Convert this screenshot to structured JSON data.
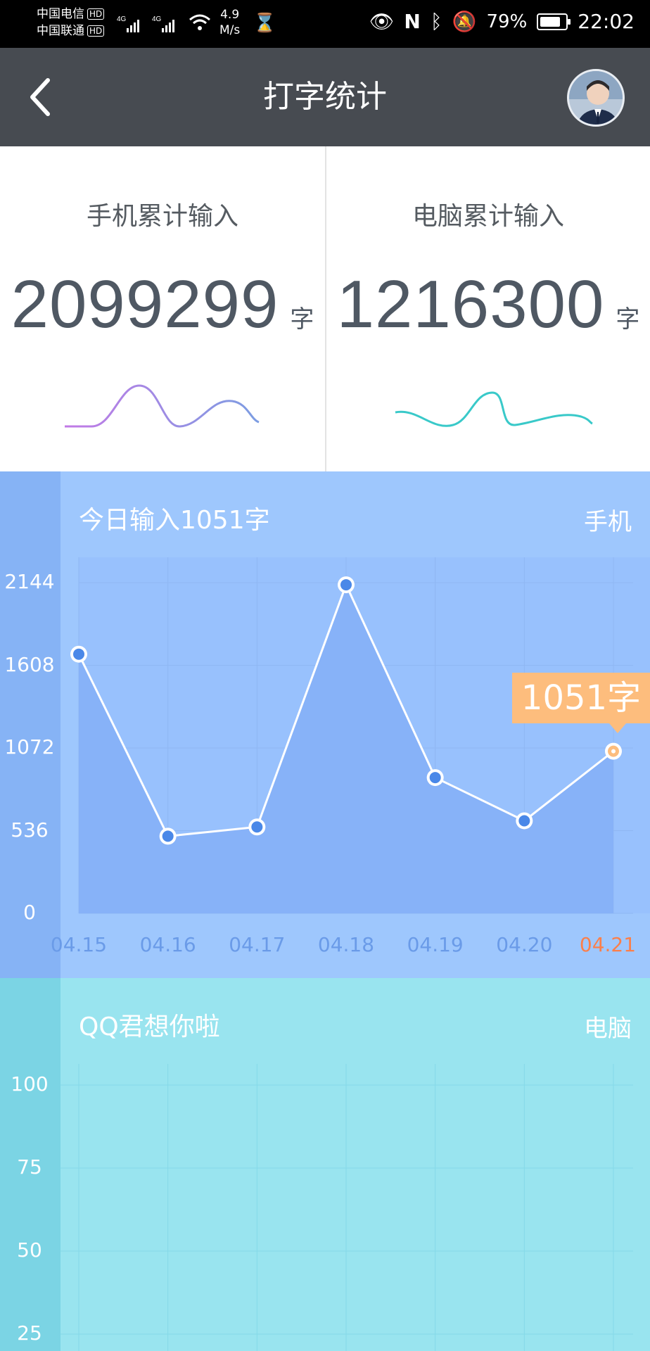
{
  "status_bar": {
    "carrier1": "中国电信",
    "carrier2": "中国联通",
    "hd": "HD",
    "net_speed_value": "4.9",
    "net_speed_unit": "M/s",
    "battery": "79%",
    "time": "22:02"
  },
  "header": {
    "title": "打字统计"
  },
  "summary": {
    "phone": {
      "label": "手机累计输入",
      "value": "2099299",
      "unit": "字"
    },
    "pc": {
      "label": "电脑累计输入",
      "value": "1216300",
      "unit": "字"
    }
  },
  "phone_chart": {
    "title": "今日输入1051字",
    "device": "手机",
    "tooltip": "1051字"
  },
  "pc_chart": {
    "title": "QQ君想你啦",
    "device": "电脑"
  },
  "chart_data": [
    {
      "type": "area",
      "x": [
        "04.15",
        "04.16",
        "04.17",
        "04.18",
        "04.19",
        "04.20",
        "04.21"
      ],
      "values": [
        1680,
        500,
        560,
        2130,
        880,
        600,
        1051
      ],
      "yticks": [
        0,
        536,
        1072,
        1608,
        2144
      ],
      "ylim": [
        0,
        2144
      ],
      "highlight_index": 6,
      "highlight_color": "#fb7f4a",
      "line_color": "#ffffff",
      "point_color": "#4a88e8",
      "grid": true
    },
    {
      "type": "line",
      "yticks": [
        25,
        50,
        75,
        100
      ],
      "values": [],
      "grid": true
    }
  ]
}
